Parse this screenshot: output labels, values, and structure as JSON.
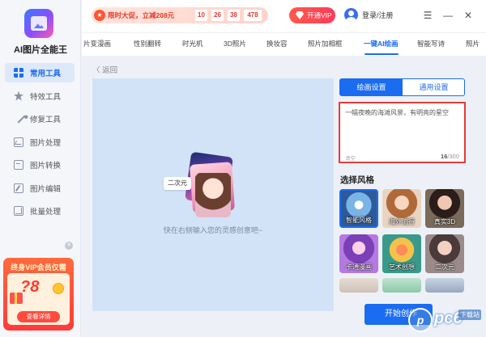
{
  "app": {
    "name": "AI图片全能王"
  },
  "sidebar": {
    "items": [
      {
        "label": "常用工具",
        "icon": "grid-icon",
        "active": true
      },
      {
        "label": "特效工具",
        "icon": "star-icon"
      },
      {
        "label": "修复工具",
        "icon": "wand-icon"
      },
      {
        "label": "图片处理",
        "icon": "chart-icon"
      },
      {
        "label": "图片转换",
        "icon": "convert-icon"
      },
      {
        "label": "图片编辑",
        "icon": "edit-icon"
      },
      {
        "label": "批量处理",
        "icon": "layers-icon"
      }
    ],
    "vip_card": {
      "title": "终身VIP会员仅需",
      "price": "?8",
      "button": "查看详情"
    }
  },
  "topbar": {
    "promo_text": "限时大促，立减208元",
    "countdown": [
      "10",
      "26",
      "38",
      "478"
    ],
    "vip_button": "开通VIP",
    "login": "登录/注册"
  },
  "tabs": [
    "片变漫画",
    "性别翻转",
    "时光机",
    "3D照片",
    "换妆容",
    "照片加相框",
    "一键AI绘画",
    "智能写诗",
    "照片"
  ],
  "active_tab": "一键AI绘画",
  "main": {
    "back": "返回",
    "badge": "二次元",
    "hint": "快在右侧输入您的灵感创意吧~"
  },
  "right_panel": {
    "tabs": [
      "绘画设置",
      "通用设置"
    ],
    "prompt_text": "一幅夜晚的海滩风景，有明亮的星空",
    "clear_label": "清空",
    "count_current": "16",
    "count_max": "/300",
    "style_title": "选择风格",
    "styles": [
      "智能风格",
      "海外流行",
      "真实3D",
      "卡通漫画",
      "艺术创想",
      "二次元",
      "",
      "",
      ""
    ],
    "create_button": "开始创作"
  },
  "watermark": {
    "text": "pc6",
    "sub": "下载站"
  },
  "colors": {
    "accent": "#1a6cf0",
    "prompt_border": "#e23b3b",
    "vip_red": "#ff3b3b"
  }
}
